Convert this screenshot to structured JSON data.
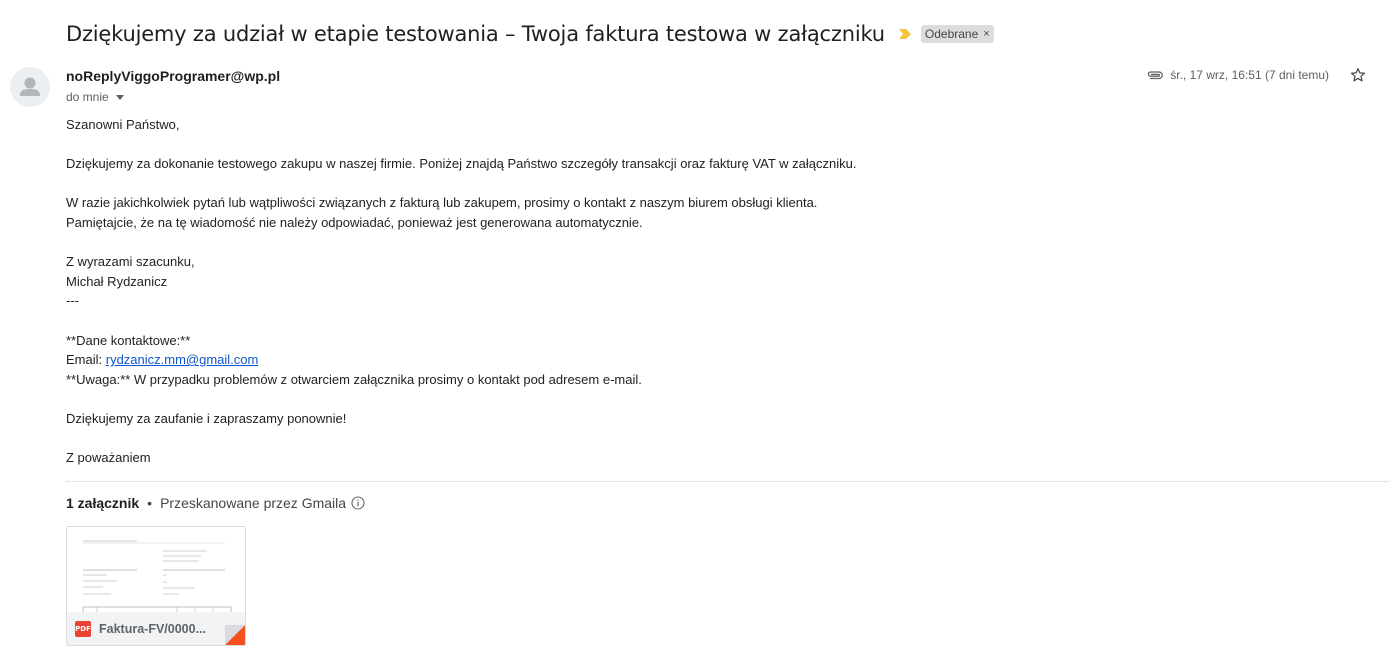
{
  "email": {
    "subject": "Dziękujemy za udział w etapie testowania – Twoja faktura testowa w załączniku",
    "label": "Odebrane",
    "label_close": "×",
    "sender": "noReplyViggoProgramer@wp.pl",
    "recipient": "do mnie",
    "date": "śr., 17 wrz, 16:51 (7 dni temu)"
  },
  "body": {
    "greeting": "Szanowni Państwo,",
    "para1": "Dziękujemy za dokonanie testowego zakupu w naszej firmie. Poniżej znajdą Państwo szczegóły transakcji oraz fakturę VAT w załączniku.",
    "para2_line1": "W razie jakichkolwiek pytań lub wątpliwości związanych z fakturą lub zakupem, prosimy o kontakt z naszym biurem obsługi klienta.",
    "para2_line2": "Pamiętajcie, że na tę wiadomość nie należy odpowiadać, ponieważ jest generowana automatycznie.",
    "regards": "Z wyrazami szacunku,",
    "signature_name": "Michał Rydzanicz",
    "separator": "---",
    "contact_heading": "**Dane kontaktowe:**",
    "email_label": "Email: ",
    "email_link": "rydzanicz.mm@gmail.com",
    "note": "**Uwaga:** W przypadku problemów z otwarciem załącznika prosimy o kontakt pod adresem e-mail.",
    "thanks": "Dziękujemy za zaufanie i zapraszamy ponownie!",
    "closing": "Z poważaniem"
  },
  "attachments": {
    "count_label": "1 załącznik",
    "separator": "•",
    "scan_label": "Przeskanowane przez Gmaila",
    "items": [
      {
        "badge": "PDF",
        "filename": "Faktura-FV/0000..."
      }
    ]
  },
  "colors": {
    "link": "#1155cc",
    "importance_marker": "#f2c53d",
    "pdf_badge": "#ea4335",
    "corner_fold": "#f4511e"
  },
  "icons": {
    "avatar": "person-icon",
    "importance": "importance-marker-icon",
    "attachment": "paperclip-icon",
    "star": "star-icon",
    "info": "info-icon",
    "dropdown": "caret-down-icon"
  }
}
